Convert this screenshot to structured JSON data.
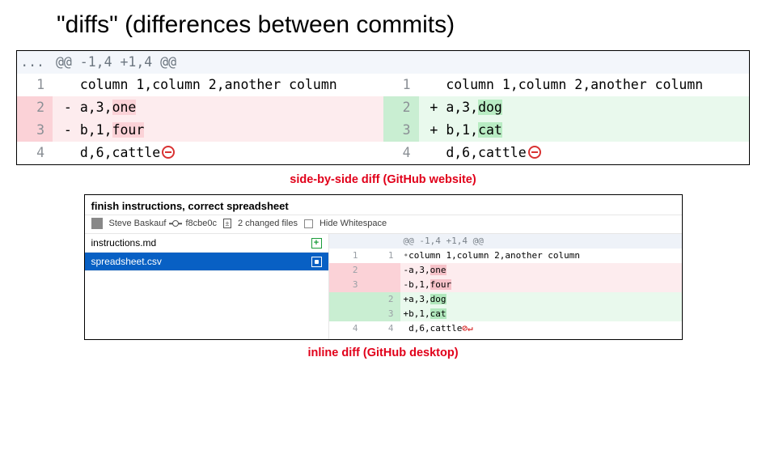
{
  "page_title": "\"diffs\" (differences between commits)",
  "captions": {
    "sbs": "side-by-side diff (GitHub website)",
    "inline": "inline diff (GitHub desktop)"
  },
  "sbs": {
    "hunk_marker": "...",
    "hunk_header": "@@ -1,4 +1,4 @@",
    "rows": [
      {
        "ln_l": "1",
        "ln_r": "1",
        "left_prefix": "   ",
        "left_text": "column 1,column 2,another column",
        "right_prefix": "   ",
        "right_text": "column 1,column 2,another column"
      },
      {
        "ln_l": "2",
        "ln_r": "2",
        "left_prefix": " - ",
        "left_base": "a,3,",
        "left_change": "one",
        "right_prefix": " + ",
        "right_base": "a,3,",
        "right_change": "dog",
        "type": "change"
      },
      {
        "ln_l": "3",
        "ln_r": "3",
        "left_prefix": " - ",
        "left_base": "b,1,",
        "left_change": "four",
        "right_prefix": " + ",
        "right_base": "b,1,",
        "right_change": "cat",
        "type": "change"
      },
      {
        "ln_l": "4",
        "ln_r": "4",
        "left_prefix": "   ",
        "left_text": "d,6,cattle",
        "right_prefix": "   ",
        "right_text": "d,6,cattle",
        "no_newline": true
      }
    ]
  },
  "desktop": {
    "title": "finish instructions, correct spreadsheet",
    "author": "Steve Baskauf",
    "sha": "f8cbe0c",
    "changed_files": "2 changed files",
    "hide_ws": "Hide Whitespace",
    "files": [
      {
        "name": "instructions.md",
        "status": "added"
      },
      {
        "name": "spreadsheet.csv",
        "status": "modified",
        "selected": true
      }
    ],
    "diff": {
      "hunk": "@@ -1,4 +1,4 @@",
      "rows": [
        {
          "old": "1",
          "new": "1",
          "prefix": " ",
          "text": "column 1,column 2,another column",
          "ctx": true
        },
        {
          "old": "2",
          "new": "",
          "prefix": "-",
          "base": "a,3,",
          "change": "one",
          "type": "del"
        },
        {
          "old": "3",
          "new": "",
          "prefix": "-",
          "base": "b,1,",
          "change": "four",
          "type": "del"
        },
        {
          "old": "",
          "new": "2",
          "prefix": "+",
          "base": "a,3,",
          "change": "dog",
          "type": "add"
        },
        {
          "old": "",
          "new": "3",
          "prefix": "+",
          "base": "b,1,",
          "change": "cat",
          "type": "add"
        },
        {
          "old": "4",
          "new": "4",
          "prefix": " ",
          "text": "d,6,cattle",
          "eof": true
        }
      ]
    }
  }
}
